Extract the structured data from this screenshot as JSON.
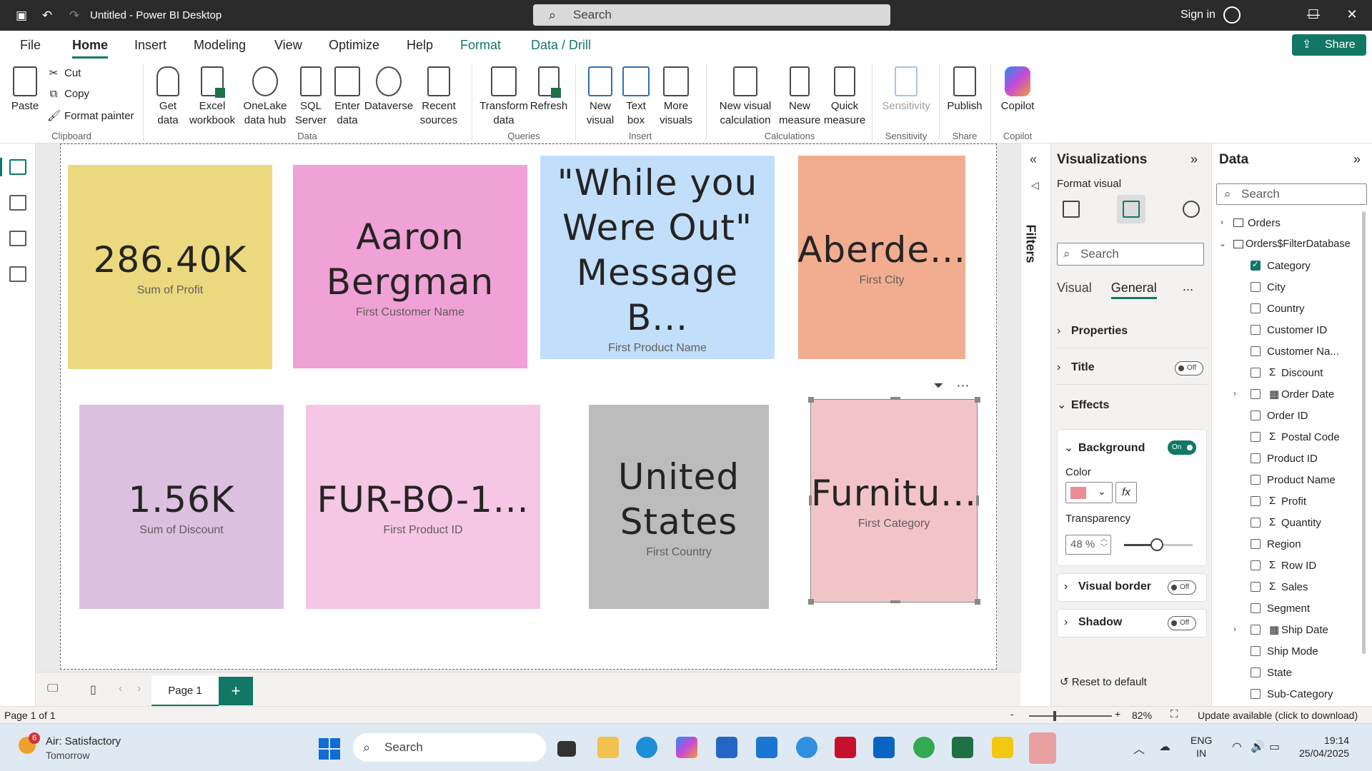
{
  "window": {
    "title": "Untitled - Power BI Desktop",
    "search_placeholder": "Search",
    "signin": "Sign in"
  },
  "tabs": [
    "File",
    "Home",
    "Insert",
    "Modeling",
    "View",
    "Optimize",
    "Help",
    "Format",
    "Data / Drill"
  ],
  "share": "Share",
  "ribbon": {
    "clipboard": {
      "paste": "Paste",
      "cut": "Cut",
      "copy": "Copy",
      "format_painter": "Format painter",
      "group": "Clipboard"
    },
    "data": {
      "get_data": "Get data",
      "excel": "Excel workbook",
      "onelake": "OneLake data hub",
      "sql": "SQL Server",
      "enter": "Enter data",
      "dataverse": "Dataverse",
      "recent": "Recent sources",
      "group": "Data"
    },
    "queries": {
      "transform": "Transform data",
      "refresh": "Refresh",
      "group": "Queries"
    },
    "insert": {
      "new_visual": "New visual",
      "text_box": "Text box",
      "more_visuals": "More visuals",
      "group": "Insert"
    },
    "calculations": {
      "new_visual_calc": "New visual calculation",
      "new_measure": "New measure",
      "quick_measure": "Quick measure",
      "group": "Calculations"
    },
    "sensitivity": {
      "label": "Sensitivity",
      "group": "Sensitivity"
    },
    "share": {
      "publish": "Publish",
      "group": "Share"
    },
    "copilot": {
      "label": "Copilot",
      "group": "Copilot"
    }
  },
  "cards": [
    {
      "value": "286.40K",
      "label": "Sum of Profit",
      "color": "#ebd97f"
    },
    {
      "value": "Aaron Bergman",
      "label": "First Customer Name",
      "color": "#f0a1d6"
    },
    {
      "value": "\"While you Were Out\" Message B...",
      "label": "First Product Name",
      "color": "#c1dffa"
    },
    {
      "value": "Aberde...",
      "label": "First City",
      "color": "#f2ad90"
    },
    {
      "value": "1.56K",
      "label": "Sum of Discount",
      "color": "#dcc0e0"
    },
    {
      "value": "FUR-BO-1...",
      "label": "First Product ID",
      "color": "#f5c7e5"
    },
    {
      "value": "United States",
      "label": "First Country",
      "color": "#bcbcbc"
    },
    {
      "value": "Furnitu...",
      "label": "First Category",
      "color": "#f2c4c8"
    }
  ],
  "filters": {
    "label": "Filters"
  },
  "visualizations": {
    "title": "Visualizations",
    "subtitle": "Format visual",
    "search_placeholder": "Search",
    "tabs": [
      "Visual",
      "General"
    ],
    "more": "...",
    "sections": {
      "properties": "Properties",
      "title": "Title",
      "title_toggle": "Off",
      "effects": "Effects",
      "background": "Background",
      "background_toggle": "On",
      "color_label": "Color",
      "fx": "fx",
      "transparency_label": "Transparency",
      "transparency_value": "48 %",
      "transparency_percent": 48,
      "visual_border": "Visual border",
      "visual_border_toggle": "Off",
      "shadow": "Shadow",
      "shadow_toggle": "Off",
      "reset": "Reset to default"
    }
  },
  "data_pane": {
    "title": "Data",
    "search_placeholder": "Search",
    "tables": [
      "Orders",
      "Orders$FilterDatabase"
    ],
    "fields": [
      {
        "name": "Category",
        "checked": true,
        "sigma": false
      },
      {
        "name": "City",
        "checked": false,
        "sigma": false
      },
      {
        "name": "Country",
        "checked": false,
        "sigma": false
      },
      {
        "name": "Customer ID",
        "checked": false,
        "sigma": false
      },
      {
        "name": "Customer Na...",
        "checked": false,
        "sigma": false
      },
      {
        "name": "Discount",
        "checked": false,
        "sigma": true
      },
      {
        "name": "Order Date",
        "checked": false,
        "sigma": false,
        "date": true
      },
      {
        "name": "Order ID",
        "checked": false,
        "sigma": false
      },
      {
        "name": "Postal Code",
        "checked": false,
        "sigma": true
      },
      {
        "name": "Product ID",
        "checked": false,
        "sigma": false
      },
      {
        "name": "Product Name",
        "checked": false,
        "sigma": false
      },
      {
        "name": "Profit",
        "checked": false,
        "sigma": true
      },
      {
        "name": "Quantity",
        "checked": false,
        "sigma": true
      },
      {
        "name": "Region",
        "checked": false,
        "sigma": false
      },
      {
        "name": "Row ID",
        "checked": false,
        "sigma": true
      },
      {
        "name": "Sales",
        "checked": false,
        "sigma": true
      },
      {
        "name": "Segment",
        "checked": false,
        "sigma": false
      },
      {
        "name": "Ship Date",
        "checked": false,
        "sigma": false,
        "date": true
      },
      {
        "name": "Ship Mode",
        "checked": false,
        "sigma": false
      },
      {
        "name": "State",
        "checked": false,
        "sigma": false
      },
      {
        "name": "Sub-Category",
        "checked": false,
        "sigma": false
      }
    ]
  },
  "pages": {
    "page1": "Page 1",
    "add": "+"
  },
  "status": {
    "page": "Page 1 of 1",
    "zoom_minus": "-",
    "zoom_plus": "+",
    "zoom_pct": "82%",
    "zoom_percent": 82,
    "update": "Update available (click to download)"
  },
  "taskbar": {
    "weather_line1": "Air: Satisfactory",
    "weather_line2": "Tomorrow",
    "weather_badge": "6",
    "search": "Search",
    "lang1": "ENG",
    "lang2": "IN",
    "time": "19:14",
    "date": "25/04/2025"
  },
  "colors": {
    "accent": "#117865",
    "titlebar": "#2b2b2b"
  }
}
